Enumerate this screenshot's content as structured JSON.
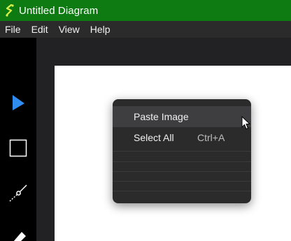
{
  "window": {
    "title": "Untitled Diagram"
  },
  "menubar": {
    "items": [
      "File",
      "Edit",
      "View",
      "Help"
    ]
  },
  "toolbar": {
    "tools": [
      "pointer-tool",
      "rectangle-tool",
      "connector-tool",
      "eraser-tool"
    ],
    "selected": "pointer-tool",
    "accent": "#2f8cf0"
  },
  "context_menu": {
    "items": [
      {
        "label": "Paste Image",
        "shortcut": "",
        "hovered": true
      },
      {
        "label": "Select All",
        "shortcut": "Ctrl+A",
        "hovered": false
      }
    ]
  },
  "colors": {
    "titlebar": "#0e7a12",
    "canvas": "#ffffff",
    "menu_bg": "#2b2b2b"
  }
}
